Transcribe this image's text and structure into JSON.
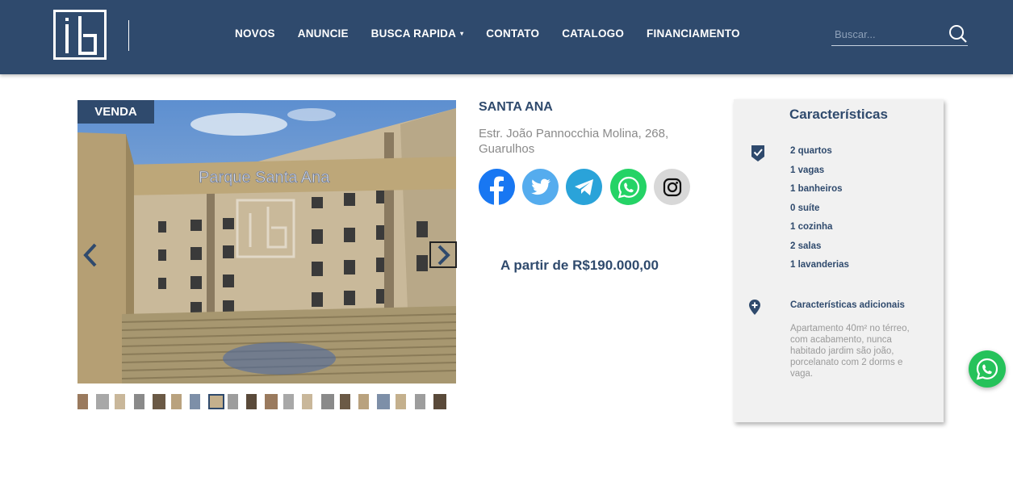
{
  "header": {
    "nav": [
      {
        "label": "NOVOS"
      },
      {
        "label": "ANUNCIE"
      },
      {
        "label": "BUSCA RAPIDA",
        "caret": "▾"
      },
      {
        "label": "CONTATO"
      },
      {
        "label": "CATALOGO"
      },
      {
        "label": "FINANCIAMENTO"
      }
    ],
    "search": {
      "placeholder": "Buscar..."
    }
  },
  "listing": {
    "badge": "VENDA",
    "sign_text": "Parque Santa Ana",
    "thumbnail_count": 20,
    "title": "SANTA ANA",
    "address": "Estr. João Pannocchia Molina, 268, Guarulhos",
    "price": "A partir de R$190.000,00",
    "social": [
      {
        "name": "facebook",
        "color": "#1877f2"
      },
      {
        "name": "twitter",
        "color": "#55acee"
      },
      {
        "name": "telegram",
        "color": "#2aa3d9"
      },
      {
        "name": "whatsapp",
        "color": "#25d366"
      },
      {
        "name": "instagram",
        "color": "#d8d8d8"
      }
    ]
  },
  "features": {
    "title": "Características",
    "items": [
      "2 quartos",
      "1 vagas",
      "1 banheiros",
      "0 suíte",
      "1 cozinha",
      "2 salas",
      "1 lavanderias"
    ],
    "additional_title": "Características adicionais",
    "additional_text": "Apartamento 40m² no térreo, com acabamento, nunca habitado jardim são joão, porcelanato com 2 dorms e vaga."
  },
  "colors": {
    "brand": "#2f4a6d",
    "whatsapp": "#25c25a"
  }
}
